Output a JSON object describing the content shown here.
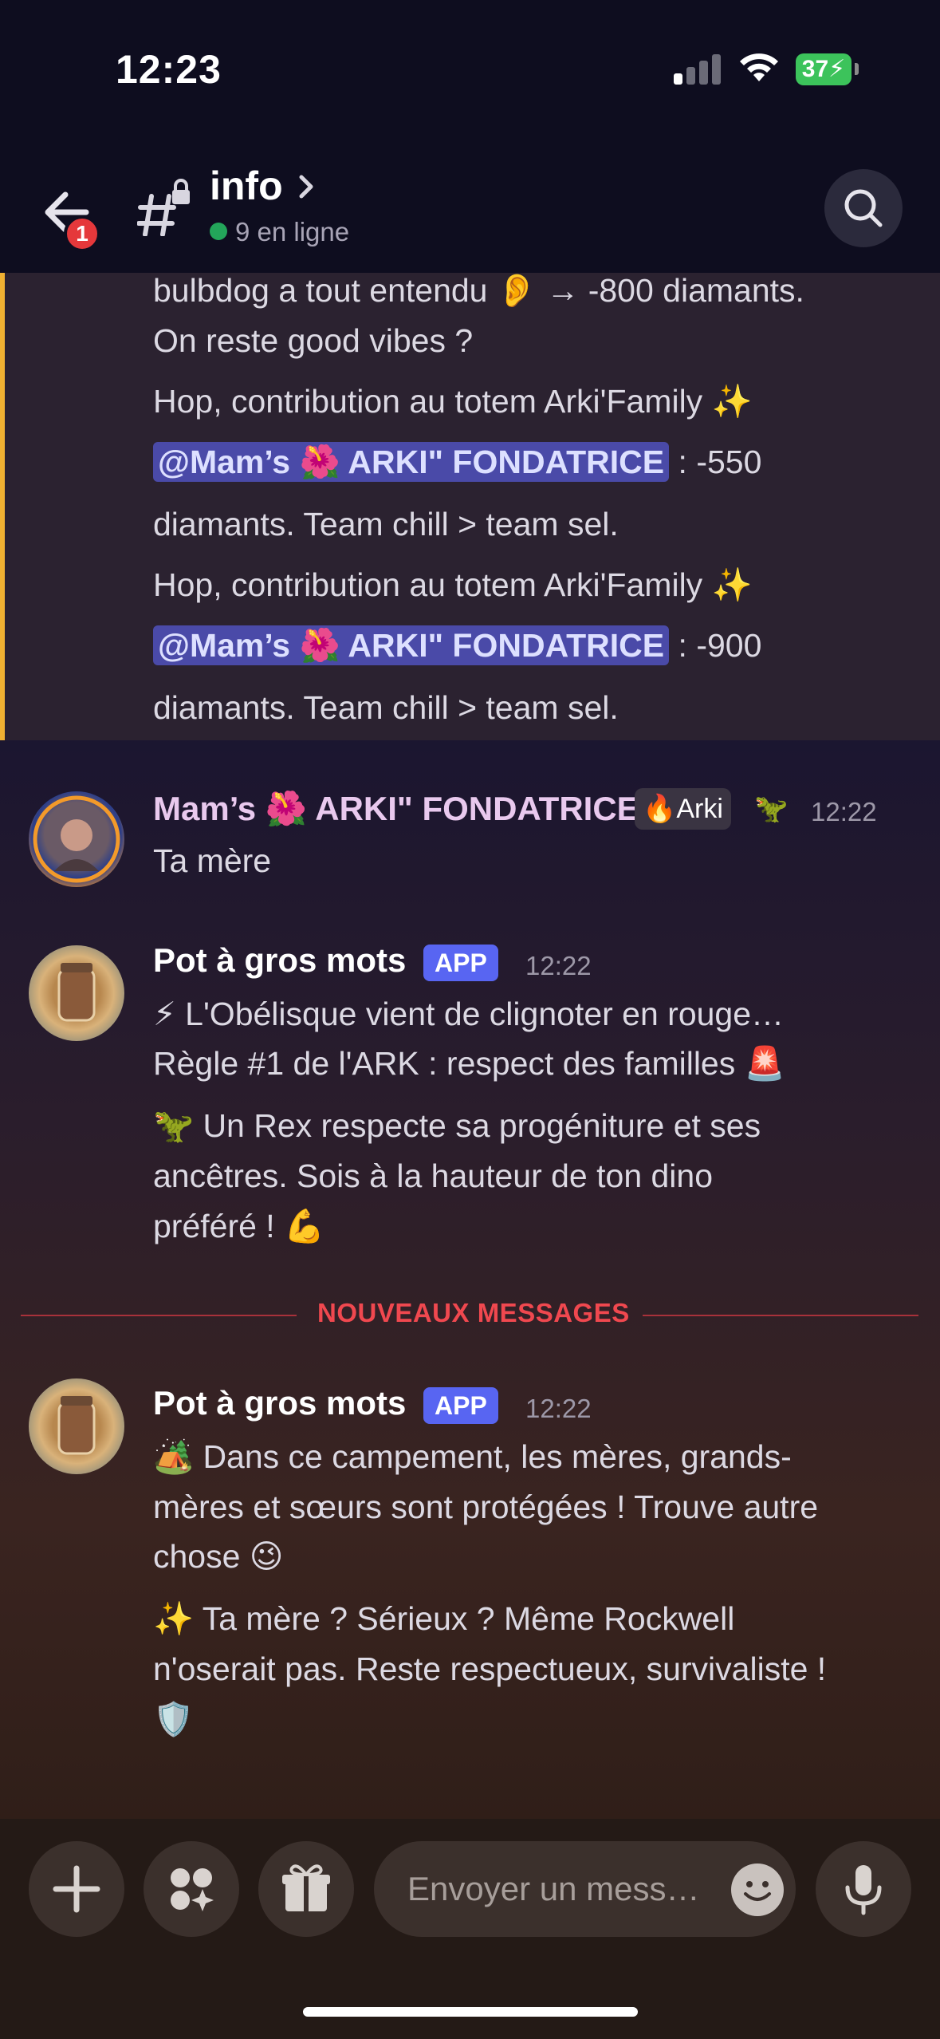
{
  "status": {
    "time": "12:23",
    "battery": "37"
  },
  "header": {
    "channel": "info",
    "online": "9 en ligne",
    "back_badge": "1"
  },
  "highlight": {
    "line1": "bulbdog a tout entendu 👂 → -800 diamants.",
    "line2": "On reste good vibes ?",
    "line3": "Hop, contribution au totem Arki'Family ✨",
    "mention1": "@Mam’s 🌺 ARKI\" FONDATRICE",
    "line4_rest": " : -550",
    "line5": "diamants. Team chill > team sel.",
    "line6": "Hop, contribution au totem Arki'Family ✨",
    "mention2": "@Mam’s 🌺 ARKI\" FONDATRICE",
    "line7_rest": " : -900",
    "line8": "diamants. Team chill > team sel."
  },
  "msg1": {
    "user": "Mam’s 🌺 ARKI\" FONDATRICE",
    "role": "Arki",
    "time": "12:22",
    "text": "Ta mère"
  },
  "msg2": {
    "user": "Pot à gros mots",
    "tag": "APP",
    "time": "12:22",
    "l1": "⚡ L'Obélisque vient de clignoter en rouge…",
    "l2": "Règle #1 de l'ARK : respect des familles 🚨",
    "l3": "🦖 Un Rex respecte sa progéniture et ses",
    "l4": "ancêtres. Sois à la hauteur de ton dino",
    "l5": "préféré ! 💪"
  },
  "divider": "NOUVEAUX MESSAGES",
  "msg3": {
    "user": "Pot à gros mots",
    "tag": "APP",
    "time": "12:22",
    "l1": "🏕️ Dans ce campement, les mères, grands-",
    "l2": "mères et sœurs sont protégées ! Trouve autre",
    "l3": "chose 😉",
    "l4": "✨ Ta mère ? Sérieux ? Même Rockwell",
    "l5": "n'oserait pas. Reste respectueux, survivaliste !",
    "l6": "🛡️"
  },
  "composer": {
    "placeholder": "Envoyer un mess…"
  }
}
